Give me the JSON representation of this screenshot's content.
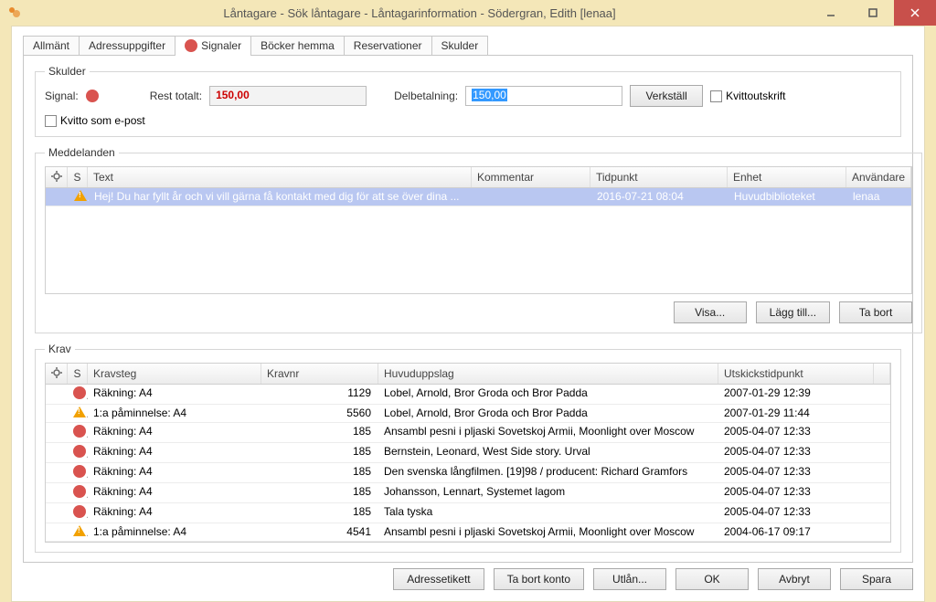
{
  "window": {
    "title": "Låntagare - Sök låntagare - Låntagarinformation - Södergran, Edith [lenaa]"
  },
  "tabs": {
    "allmant": "Allmänt",
    "adress": "Adressuppgifter",
    "signaler": "Signaler",
    "bocker": "Böcker hemma",
    "reservationer": "Reservationer",
    "skulder": "Skulder"
  },
  "skulder": {
    "legend": "Skulder",
    "signal_label": "Signal:",
    "rest_label": "Rest totalt:",
    "rest_value": "150,00",
    "delbet_label": "Delbetalning:",
    "delbet_value": "150,00",
    "verkstall": "Verkställ",
    "kvitto": "Kvittoutskrift",
    "kvitto_epost": "Kvitto som e-post"
  },
  "meddelanden": {
    "legend": "Meddelanden",
    "cols": {
      "s": "S",
      "text": "Text",
      "kommentar": "Kommentar",
      "tid": "Tidpunkt",
      "enhet": "Enhet",
      "anv": "Användare"
    },
    "rows": [
      {
        "icon": "warn",
        "text": "Hej! Du har fyllt år och vi vill gärna få kontakt med dig för att se över dina ...",
        "kommentar": "",
        "tid": "2016-07-21 08:04",
        "enhet": "Huvudbiblioteket",
        "anv": "lenaa"
      }
    ],
    "buttons": {
      "visa": "Visa...",
      "lagg": "Lägg till...",
      "tabort": "Ta bort"
    }
  },
  "krav": {
    "legend": "Krav",
    "cols": {
      "s": "S",
      "kravsteg": "Kravsteg",
      "kravnr": "Kravnr",
      "huvud": "Huvuduppslag",
      "utskick": "Utskickstidpunkt"
    },
    "rows": [
      {
        "icon": "stop",
        "kravsteg": "Räkning: A4",
        "kravnr": "1129",
        "huvud": "Lobel, Arnold, Bror Groda och Bror Padda",
        "utskick": "2007-01-29 12:39"
      },
      {
        "icon": "warn",
        "kravsteg": "1:a påminnelse: A4",
        "kravnr": "5560",
        "huvud": "Lobel, Arnold, Bror Groda och Bror Padda",
        "utskick": "2007-01-29 11:44"
      },
      {
        "icon": "stop",
        "kravsteg": "Räkning: A4",
        "kravnr": "185",
        "huvud": "Ansambl pesni i pljaski Sovetskoj Armii, Moonlight over Moscow",
        "utskick": "2005-04-07 12:33"
      },
      {
        "icon": "stop",
        "kravsteg": "Räkning: A4",
        "kravnr": "185",
        "huvud": "Bernstein, Leonard, West Side story. Urval",
        "utskick": "2005-04-07 12:33"
      },
      {
        "icon": "stop",
        "kravsteg": "Räkning: A4",
        "kravnr": "185",
        "huvud": "Den svenska långfilmen. [19]98 / producent: Richard Gramfors",
        "utskick": "2005-04-07 12:33"
      },
      {
        "icon": "stop",
        "kravsteg": "Räkning: A4",
        "kravnr": "185",
        "huvud": "Johansson, Lennart, Systemet lagom",
        "utskick": "2005-04-07 12:33"
      },
      {
        "icon": "stop",
        "kravsteg": "Räkning: A4",
        "kravnr": "185",
        "huvud": "Tala tyska",
        "utskick": "2005-04-07 12:33"
      },
      {
        "icon": "warn",
        "kravsteg": "1:a påminnelse: A4",
        "kravnr": "4541",
        "huvud": "Ansambl pesni i pljaski Sovetskoj Armii, Moonlight over Moscow",
        "utskick": "2004-06-17 09:17"
      }
    ]
  },
  "footer": {
    "adress": "Adressetikett",
    "tabort": "Ta bort konto",
    "utlan": "Utlån...",
    "ok": "OK",
    "avbryt": "Avbryt",
    "spara": "Spara"
  }
}
